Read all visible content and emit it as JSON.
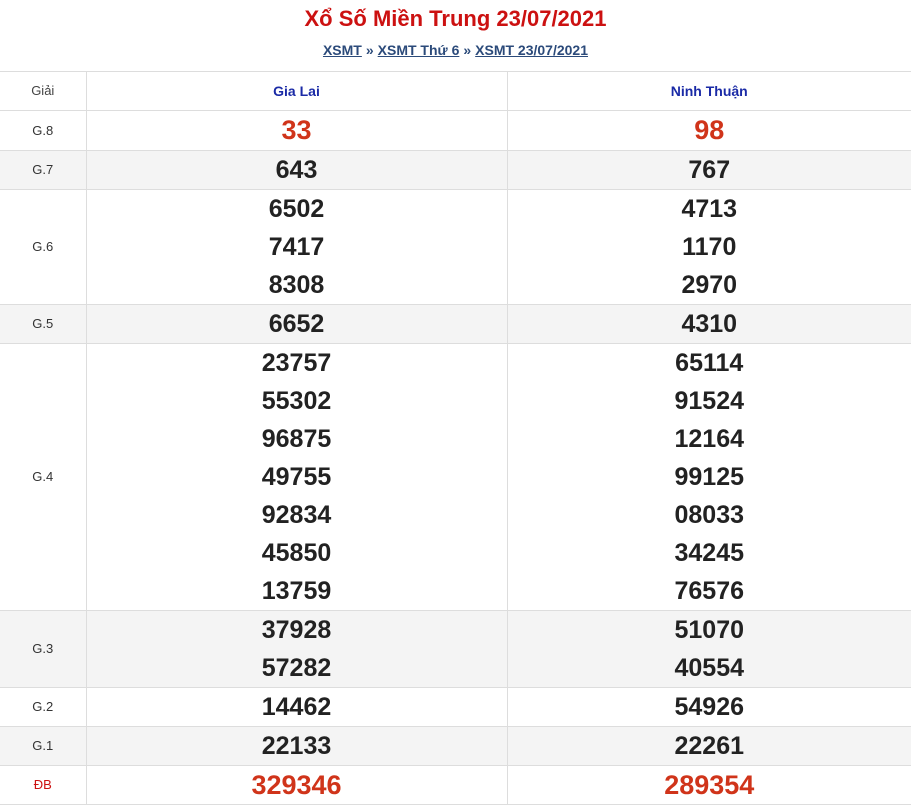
{
  "header": {
    "title": "Xổ Số Miền Trung 23/07/2021",
    "breadcrumb": [
      "XSMT",
      "XSMT Thứ 6",
      "XSMT 23/07/2021"
    ],
    "separator": "»"
  },
  "table": {
    "label_header": "Giải",
    "provinces": [
      "Gia Lai",
      "Ninh Thuận"
    ],
    "rows": [
      {
        "label": "G.8",
        "gia_lai": [
          "33"
        ],
        "ninh_thuan": [
          "98"
        ]
      },
      {
        "label": "G.7",
        "gia_lai": [
          "643"
        ],
        "ninh_thuan": [
          "767"
        ]
      },
      {
        "label": "G.6",
        "gia_lai": [
          "6502",
          "7417",
          "8308"
        ],
        "ninh_thuan": [
          "4713",
          "1170",
          "2970"
        ]
      },
      {
        "label": "G.5",
        "gia_lai": [
          "6652"
        ],
        "ninh_thuan": [
          "4310"
        ]
      },
      {
        "label": "G.4",
        "gia_lai": [
          "23757",
          "55302",
          "96875",
          "49755",
          "92834",
          "45850",
          "13759"
        ],
        "ninh_thuan": [
          "65114",
          "91524",
          "12164",
          "99125",
          "08033",
          "34245",
          "76576"
        ]
      },
      {
        "label": "G.3",
        "gia_lai": [
          "37928",
          "57282"
        ],
        "ninh_thuan": [
          "51070",
          "40554"
        ]
      },
      {
        "label": "G.2",
        "gia_lai": [
          "14462"
        ],
        "ninh_thuan": [
          "54926"
        ]
      },
      {
        "label": "G.1",
        "gia_lai": [
          "22133"
        ],
        "ninh_thuan": [
          "22261"
        ]
      },
      {
        "label": "ĐB",
        "gia_lai": [
          "329346"
        ],
        "ninh_thuan": [
          "289354"
        ]
      }
    ]
  },
  "colors": {
    "title": "#cc1111",
    "breadcrumb": "#2b4a7a",
    "province_header": "#1a2aa6",
    "highlight_number": "#d0341a",
    "row_alt_bg": "#f4f4f4"
  }
}
